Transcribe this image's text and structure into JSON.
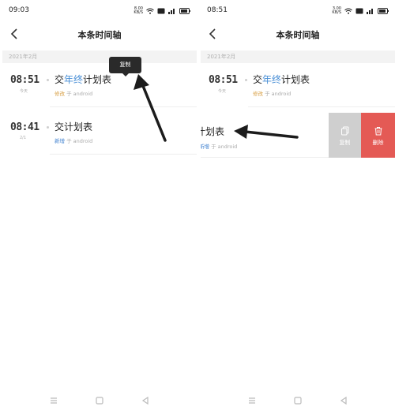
{
  "left": {
    "status": {
      "time": "09:03",
      "net_speed": "8.00",
      "net_unit": "KB/S"
    },
    "page_title": "本条时间轴",
    "month": "2021年2月",
    "tooltip": "复制",
    "entries": [
      {
        "time": "08:51",
        "date": "今天",
        "title_pre": "交",
        "title_hl": "年终",
        "title_post": "计划表",
        "action": "修改",
        "via": "于 android"
      },
      {
        "time": "08:41",
        "date": "2/1",
        "title_pre": "交计划表",
        "title_hl": "",
        "title_post": "",
        "action": "新增",
        "via": "于 android"
      }
    ]
  },
  "right": {
    "status": {
      "time": "08:51",
      "net_speed": "3.00",
      "net_unit": "KB/S"
    },
    "page_title": "本条时间轴",
    "month": "2021年2月",
    "entry": {
      "time": "08:51",
      "date": "今天",
      "title_pre": "交",
      "title_hl": "年终",
      "title_post": "计划表",
      "action": "修改",
      "via": "于 android"
    },
    "swipe": {
      "title": "计划表",
      "action": "新增",
      "via": "于 android",
      "copy_label": "复制",
      "delete_label": "删除"
    }
  },
  "colors": {
    "accent_blue": "#4a8fd6",
    "edit_orange": "#d8a046",
    "delete_red": "#e45a55",
    "copy_gray": "#cfcfcf",
    "tooltip_bg": "#2a2a2a"
  },
  "icons": [
    "wifi-icon",
    "signal-icon",
    "battery-icon",
    "back-arrow-icon",
    "copy-icon",
    "trash-icon",
    "menu-nav-icon",
    "home-nav-icon",
    "back-nav-icon"
  ]
}
